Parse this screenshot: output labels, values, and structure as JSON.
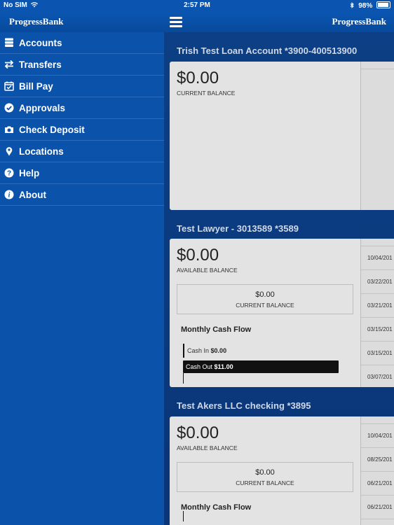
{
  "status_bar": {
    "carrier": "No SIM",
    "time": "2:57 PM",
    "battery": "98%"
  },
  "header": {
    "logo_left": "ProgressBank",
    "logo_right": "ProgressBank"
  },
  "sidebar": {
    "items": [
      {
        "label": "Accounts",
        "icon": "accounts-icon"
      },
      {
        "label": "Transfers",
        "icon": "transfers-icon"
      },
      {
        "label": "Bill Pay",
        "icon": "calendar-check-icon"
      },
      {
        "label": "Approvals",
        "icon": "check-circle-icon"
      },
      {
        "label": "Check Deposit",
        "icon": "camera-icon"
      },
      {
        "label": "Locations",
        "icon": "location-pin-icon"
      },
      {
        "label": "Help",
        "icon": "question-circle-icon"
      },
      {
        "label": "About",
        "icon": "info-circle-icon"
      }
    ]
  },
  "accounts": [
    {
      "title": "Trish Test Loan Account *3900-400513900",
      "balance": "$0.00",
      "balance_label": "CURRENT BALANCE"
    },
    {
      "title": "Test Lawyer - 3013589 *3589",
      "balance": "$0.00",
      "balance_label": "AVAILABLE BALANCE",
      "current_balance": "$0.00",
      "current_balance_label": "CURRENT BALANCE",
      "cash_flow_title": "Monthly Cash Flow",
      "cash_in_label": "Cash In",
      "cash_in_value": "$0.00",
      "cash_out_label": "Cash Out",
      "cash_out_value": "$11.00",
      "dates": [
        "10/04/201",
        "03/22/201",
        "03/21/201",
        "03/15/201",
        "03/15/201",
        "03/07/201"
      ]
    },
    {
      "title": "Test Akers LLC checking *3895",
      "balance": "$0.00",
      "balance_label": "AVAILABLE BALANCE",
      "current_balance": "$0.00",
      "current_balance_label": "CURRENT BALANCE",
      "cash_flow_title": "Monthly Cash Flow",
      "dates": [
        "10/04/201",
        "08/25/201",
        "06/21/201",
        "06/21/201"
      ]
    }
  ],
  "colors": {
    "brand_blue": "#0a52aa",
    "card_bg": "#e3e3e3"
  }
}
